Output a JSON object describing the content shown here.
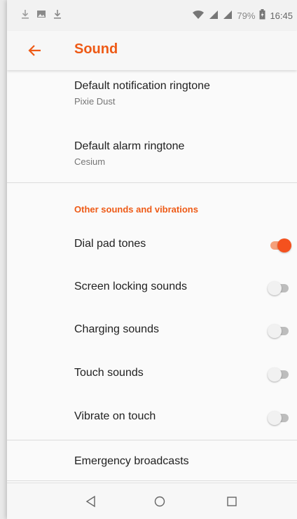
{
  "status_bar": {
    "icons": [
      "download-icon",
      "image-icon",
      "download-icon",
      "wifi-icon",
      "signal-icon",
      "signal-icon",
      "battery-icon"
    ],
    "battery": "79%",
    "time": "16:45"
  },
  "app_bar": {
    "title": "Sound",
    "back_icon": "arrow-left-icon",
    "accent": "#ee5a16"
  },
  "items": {
    "notification_ringtone": {
      "title": "Default notification ringtone",
      "value": "Pixie Dust"
    },
    "alarm_ringtone": {
      "title": "Default alarm ringtone",
      "value": "Cesium"
    }
  },
  "section": {
    "header": "Other sounds and vibrations"
  },
  "toggles": [
    {
      "label": "Dial pad tones",
      "on": true
    },
    {
      "label": "Screen locking sounds",
      "on": false
    },
    {
      "label": "Charging sounds",
      "on": false
    },
    {
      "label": "Touch sounds",
      "on": false
    },
    {
      "label": "Vibrate on touch",
      "on": false
    }
  ],
  "emergency": {
    "title": "Emergency broadcasts"
  },
  "nav_bar": {
    "icons": [
      "back-triangle-icon",
      "home-circle-icon",
      "recents-square-icon"
    ]
  }
}
